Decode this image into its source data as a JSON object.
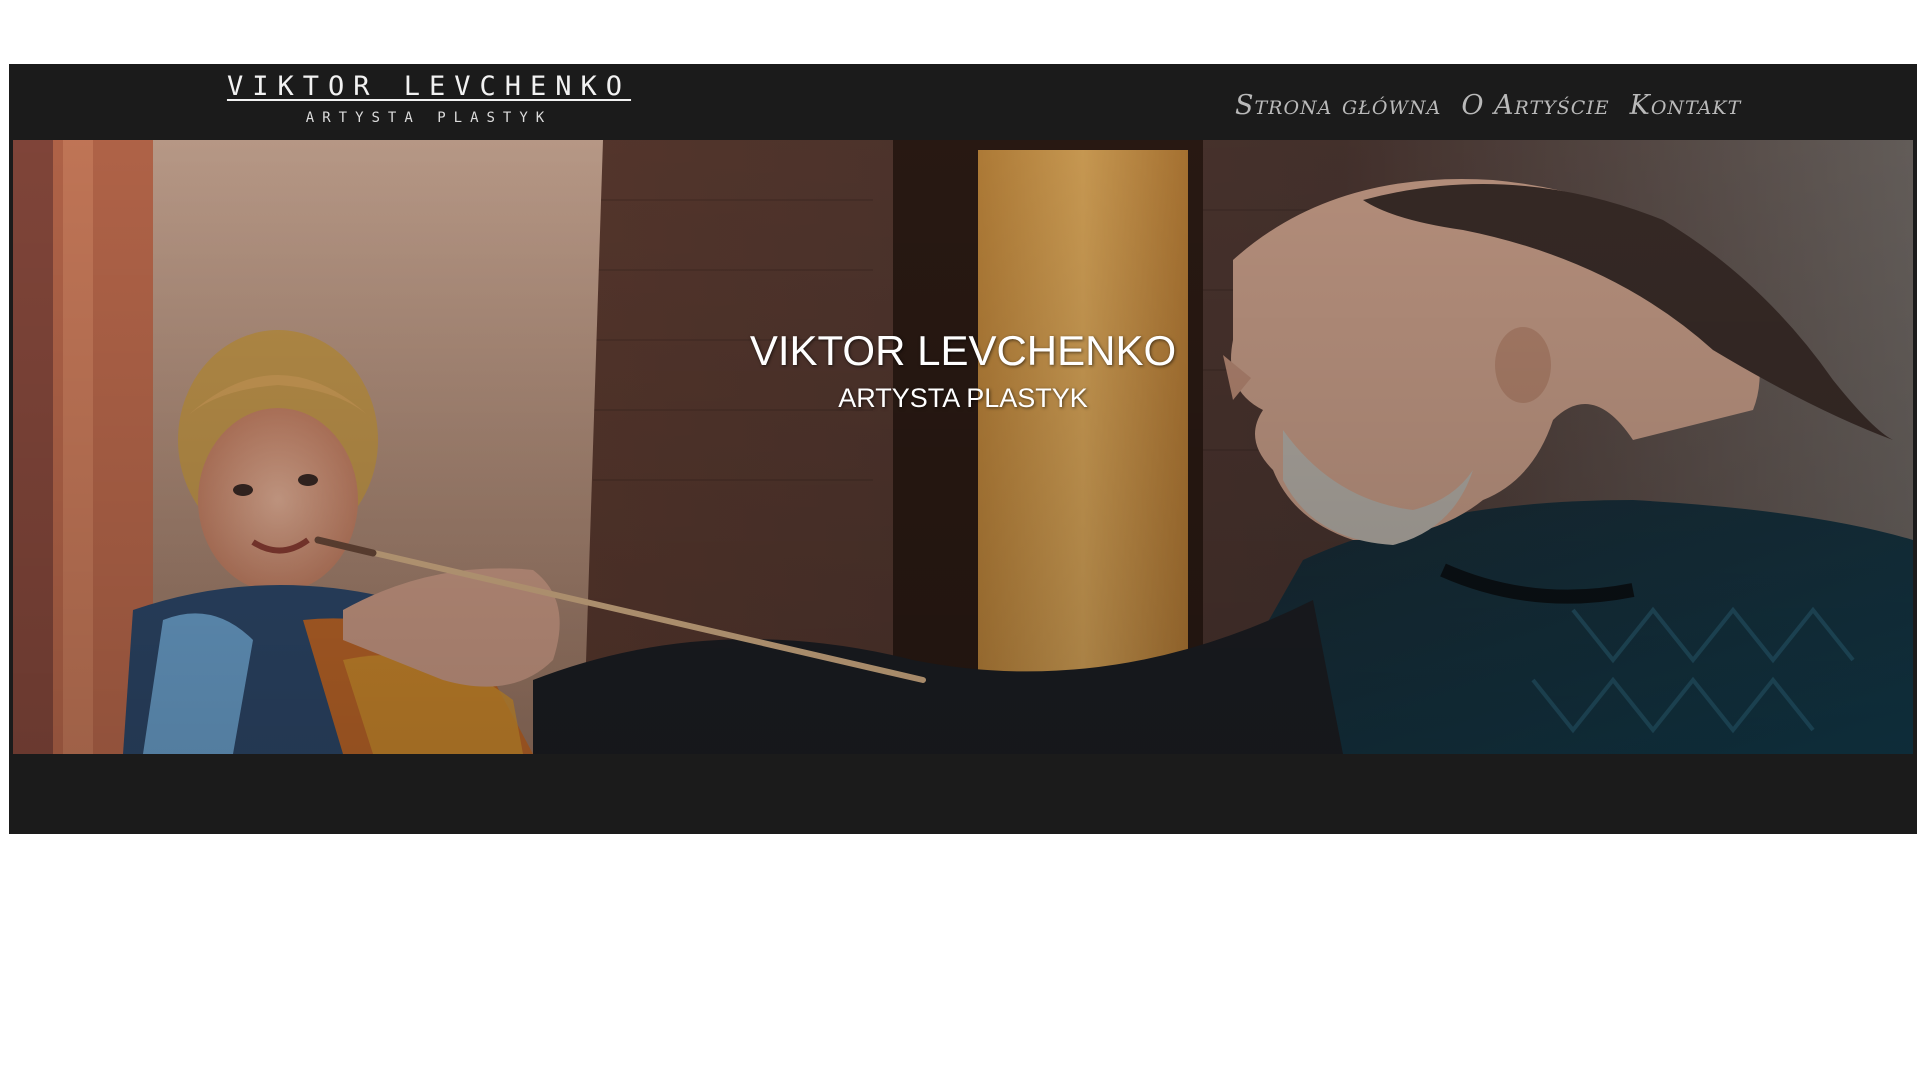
{
  "header": {
    "logo_name": "VIKTOR LEVCHENKO",
    "logo_subtitle": "ARTYSTA PLASTYK"
  },
  "nav": {
    "items": [
      {
        "label": "Strona główna"
      },
      {
        "label": "O Artyście"
      },
      {
        "label": "Kontakt"
      }
    ]
  },
  "hero": {
    "title": "VIKTOR LEVCHENKO",
    "subtitle": "ARTYSTA PLASTYK"
  },
  "colors": {
    "page_background": "#ffffff",
    "site_background": "#1b1b1b",
    "logo_text": "#f2f2f2",
    "nav_text": "#b9b9b9",
    "hero_text": "#ffffff"
  }
}
